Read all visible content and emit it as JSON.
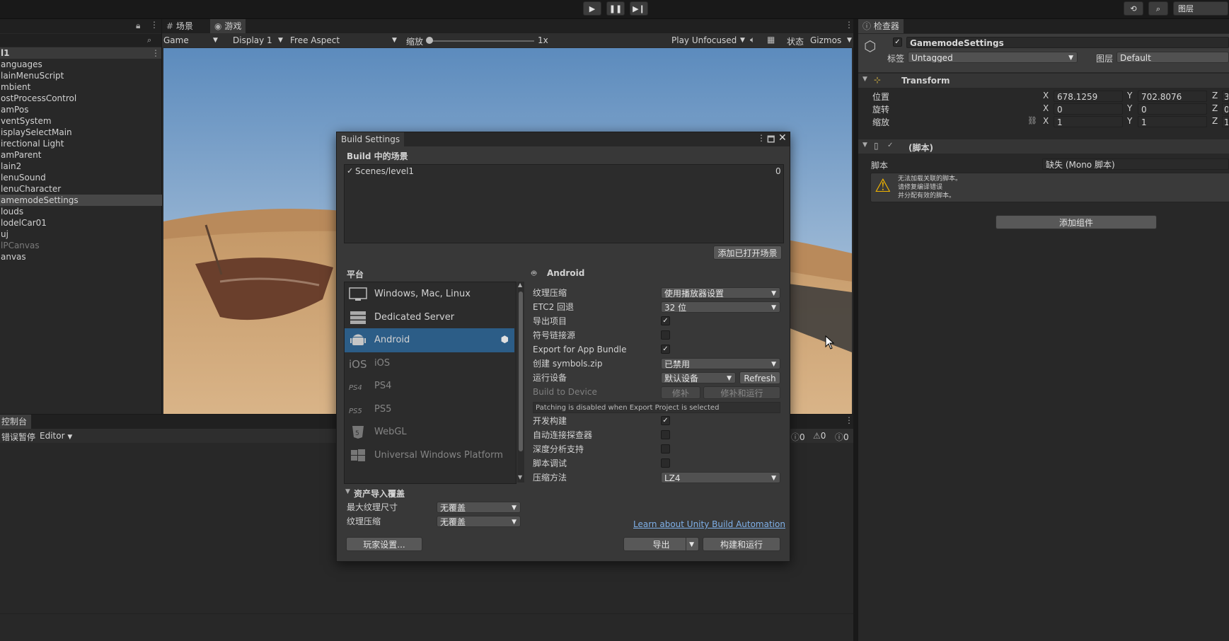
{
  "top": {
    "layers_label": "图层"
  },
  "hierarchy": {
    "header": "l1",
    "items": [
      "anguages",
      "lainMenuScript",
      "mbient",
      "ostProcessControl",
      "amPos",
      "ventSystem",
      "isplaySelectMain",
      "irectional Light",
      "amParent",
      "lain2",
      "lenuSound",
      "lenuCharacter",
      "amemodeSettings",
      "louds",
      "lodelCar01",
      "uj",
      "lPCanvas",
      "anvas"
    ],
    "selected_index": 12,
    "dimmed_index": 16
  },
  "scene_tabs": {
    "scene": "场景",
    "game": "游戏"
  },
  "game_toolbar": {
    "game": "Game",
    "display": "Display 1",
    "aspect": "Free Aspect",
    "scale_label": "缩放",
    "scale_value": "1x",
    "play_mode": "Play Unfocused",
    "stats": "状态",
    "gizmos": "Gizmos"
  },
  "console": {
    "tab": "控制台",
    "pause": "错误暂停",
    "editor": "Editor",
    "count_info": "0",
    "count_warn": "0",
    "count_err": "0"
  },
  "build": {
    "title": "Build Settings",
    "scenes_header": "Build 中的场景",
    "scene_item": "Scenes/level1",
    "scene_index": "0",
    "add_open_scenes": "添加已打开场景",
    "platform_header": "平台",
    "platforms": [
      "Windows, Mac, Linux",
      "Dedicated Server",
      "Android",
      "iOS",
      "PS4",
      "PS5",
      "WebGL",
      "Universal Windows Platform"
    ],
    "selected_platform": "Android",
    "platform_title": "Android",
    "options": {
      "texture_compression": "纹理压缩",
      "texture_compression_value": "使用播放器设置",
      "etc2": "ETC2 回退",
      "etc2_value": "32 位",
      "export_project": "导出项目",
      "symlink": "符号链接源",
      "export_bundle": "Export for App Bundle",
      "symbols_zip": "创建 symbols.zip",
      "symbols_zip_value": "已禁用",
      "run_device": "运行设备",
      "run_device_value": "默认设备",
      "refresh": "Refresh",
      "build_to_device": "Build to Device",
      "patch": "修补",
      "patch_and_run": "修补和运行",
      "patching_note": "Patching is disabled when Export Project is selected",
      "dev_build": "开发构建",
      "autoconnect_profiler": "自动连接探查器",
      "deep_profiling": "深度分析支持",
      "script_debugging": "脚本调试",
      "compression_method": "压缩方法",
      "compression_method_value": "LZ4"
    },
    "asset_override": "资产导入覆盖",
    "max_texture_size": "最大纹理尺寸",
    "max_texture_size_value": "无覆盖",
    "tex_compress": "纹理压缩",
    "tex_compress_value": "无覆盖",
    "player_settings": "玩家设置...",
    "learn_link": "Learn about Unity Build Automation",
    "export": "导出",
    "build_and_run": "构建和运行"
  },
  "inspector": {
    "tab": "检查器",
    "object_name": "GamemodeSettings",
    "tag_label": "标签",
    "tag_value": "Untagged",
    "layer_label": "图层",
    "layer_value": "Default",
    "transform": "Transform",
    "position": "位置",
    "rotation": "旋转",
    "scale": "缩放",
    "pos_x": "678.1259",
    "pos_y": "702.8076",
    "rot_x": "0",
    "rot_y": "0",
    "scl_x": "1",
    "scl_y": "1",
    "axis_x": "X",
    "axis_y": "Y",
    "axis_z": "Z",
    "z_pos": "3",
    "z_rot": "0",
    "z_scl": "1",
    "script_header": "(脚本)",
    "script_label": "脚本",
    "script_value": "缺失 (Mono 脚本)",
    "warning_lines": [
      "无法加载关联的脚本。",
      "请修复编译错误",
      "并分配有效的脚本。"
    ],
    "add_component": "添加组件"
  }
}
